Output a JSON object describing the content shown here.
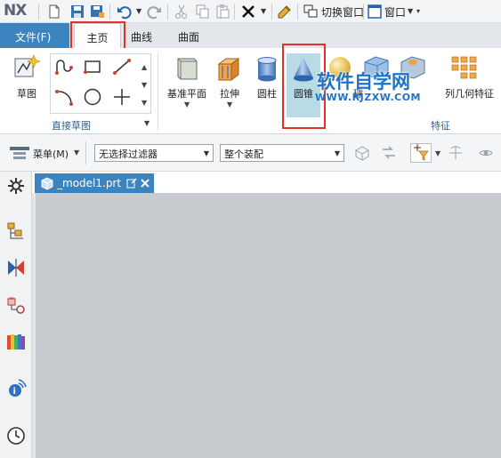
{
  "app": {
    "logo": "NX"
  },
  "quick_access": {
    "switch_window_label": "切换窗口",
    "window_label": "窗口"
  },
  "tabs": {
    "file": "文件(F)",
    "items": [
      {
        "label": "主页",
        "active": true
      },
      {
        "label": "曲线",
        "active": false
      },
      {
        "label": "曲面",
        "active": false
      }
    ]
  },
  "ribbon": {
    "sketch_label": "草图",
    "direct_sketch_group": "直接草图",
    "datum_plane_label": "基准平面",
    "extrude_label": "拉伸",
    "cylinder_label": "圆柱",
    "cone_label": "圆锥",
    "sphere_partial": "球",
    "pattern_partial": "列几何特征",
    "feature_group": "特征"
  },
  "watermark": {
    "title": "软件自学网",
    "url": "WWW.RJZXW.COM"
  },
  "toolbar2": {
    "menu_label": "菜单(M)",
    "filter_value": "无选择过滤器",
    "assembly_value": "整个装配"
  },
  "document": {
    "tab_name": "_model1.prt"
  },
  "colors": {
    "accent_blue": "#3c84bf",
    "highlight_red": "#e2302b",
    "viewport_gray": "#c8ccd0"
  }
}
